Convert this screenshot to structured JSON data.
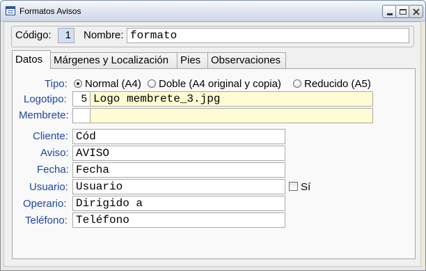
{
  "window": {
    "title": "Formatos Avisos",
    "icon": "form-icon"
  },
  "header": {
    "codigo_label": "Código:",
    "codigo_value": "1",
    "nombre_label": "Nombre:",
    "nombre_value": "formato"
  },
  "tabs": [
    {
      "label": "Datos",
      "active": true
    },
    {
      "label": "Márgenes y Localización",
      "active": false
    },
    {
      "label": "Pies",
      "active": false
    },
    {
      "label": "Observaciones",
      "active": false
    }
  ],
  "datos": {
    "tipo_label": "Tipo:",
    "tipo_options": [
      {
        "label": "Normal (A4)",
        "selected": true
      },
      {
        "label": "Doble (A4 original y copia)",
        "selected": false
      },
      {
        "label": "Reducido (A5)",
        "selected": false
      }
    ],
    "logotipo_label": "Logotipo:",
    "logotipo_num": "5",
    "logotipo_value": "Logo membrete_3.jpg",
    "membrete_label": "Membrete:",
    "membrete_num": "",
    "membrete_value": "",
    "cliente_label": "Cliente:",
    "cliente_value": "Cód",
    "aviso_label": "Aviso:",
    "aviso_value": "AVISO",
    "fecha_label": "Fecha:",
    "fecha_value": "Fecha",
    "usuario_label": "Usuario:",
    "usuario_value": "Usuario",
    "si_label": "Sí",
    "si_checked": false,
    "operario_label": "Operario:",
    "operario_value": "Dirigido a",
    "telefono_label": "Teléfono:",
    "telefono_value": "Teléfono"
  },
  "colors": {
    "label_blue": "#1c46a2",
    "highlight_field": "#fffbd2"
  }
}
